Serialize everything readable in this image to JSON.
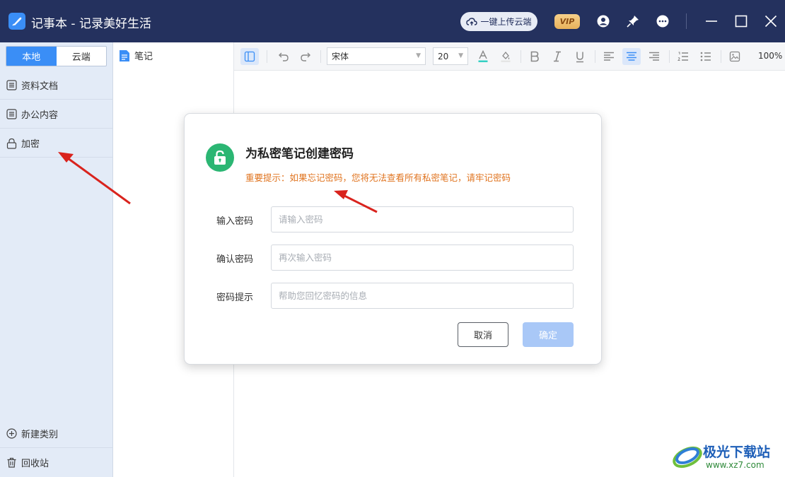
{
  "window": {
    "title": "记事本 - 记录美好生活",
    "upload_label": "一键上传云端",
    "vip_label": "VIP"
  },
  "sidebar": {
    "tabs": [
      {
        "label": "本地",
        "active": true
      },
      {
        "label": "云端",
        "active": false
      }
    ],
    "items": [
      {
        "label": "资料文档",
        "icon": "list-doc-icon"
      },
      {
        "label": "办公内容",
        "icon": "list-doc-icon"
      },
      {
        "label": "加密",
        "icon": "lock-icon"
      }
    ],
    "new_category_label": "新建类别",
    "recycle_label": "回收站"
  },
  "notelist": {
    "items": [
      {
        "label": "笔记",
        "icon": "note-file-icon"
      }
    ]
  },
  "toolbar": {
    "font_family": "宋体",
    "font_size": "20",
    "zoom": "100%"
  },
  "dialog": {
    "title": "为私密笔记创建密码",
    "warning": "重要提示：如果忘记密码，您将无法查看所有私密笔记，请牢记密码",
    "fields": [
      {
        "label": "输入密码",
        "placeholder": "请输入密码",
        "value": ""
      },
      {
        "label": "确认密码",
        "placeholder": "再次输入密码",
        "value": ""
      },
      {
        "label": "密码提示",
        "placeholder": "帮助您回忆密码的信息",
        "value": ""
      }
    ],
    "cancel_label": "取消",
    "confirm_label": "确定"
  },
  "watermark": {
    "text": "极光下载站",
    "url": "www.xz7.com"
  },
  "colors": {
    "titlebar": "#24315e",
    "accent": "#3a8ef6",
    "success": "#2bb673",
    "warning": "#e07420",
    "annotation_arrow": "#d9231d"
  }
}
